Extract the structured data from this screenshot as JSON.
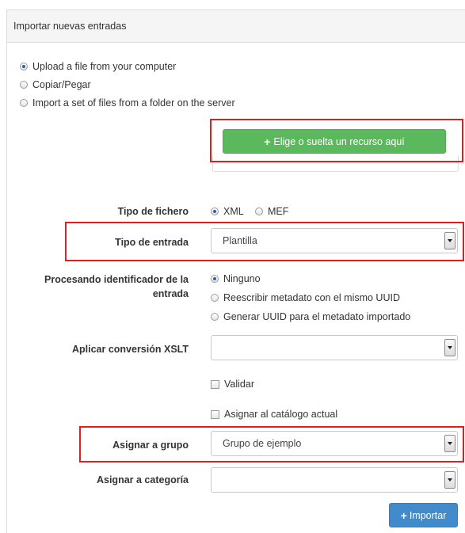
{
  "panel": {
    "title": "Importar nuevas entradas"
  },
  "source_options": [
    {
      "label": "Upload a file from your computer",
      "selected": true
    },
    {
      "label": "Copiar/Pegar",
      "selected": false
    },
    {
      "label": "Import a set of files from a folder on the server",
      "selected": false
    }
  ],
  "upload": {
    "button_label": "Elige o suelta un recurso aquí",
    "icon": "plus-icon"
  },
  "file_type": {
    "label": "Tipo de fichero",
    "options": [
      {
        "label": "XML",
        "selected": true
      },
      {
        "label": "MEF",
        "selected": false
      }
    ]
  },
  "entry_type": {
    "label": "Tipo de entrada",
    "value": "Plantilla"
  },
  "identifier": {
    "label_line1": "Procesando identificador de la",
    "label_line2": "entrada",
    "options": [
      {
        "label": "Ninguno",
        "selected": true
      },
      {
        "label": "Reescribir metadato con el mismo UUID",
        "selected": false
      },
      {
        "label": "Generar UUID para el metadato importado",
        "selected": false
      }
    ]
  },
  "xslt": {
    "label": "Aplicar conversión XSLT",
    "value": ""
  },
  "validate": {
    "label": "Validar",
    "checked": false
  },
  "assign_catalog": {
    "label": "Asignar al catálogo actual",
    "checked": false
  },
  "group": {
    "label": "Asignar a grupo",
    "value": "Grupo de ejemplo"
  },
  "category": {
    "label": "Asignar a categoría",
    "value": ""
  },
  "import_button": {
    "label": "Importar",
    "icon": "plus-icon"
  },
  "colors": {
    "highlight": "#e01e1e",
    "success": "#5cb85c",
    "primary": "#428bca"
  }
}
